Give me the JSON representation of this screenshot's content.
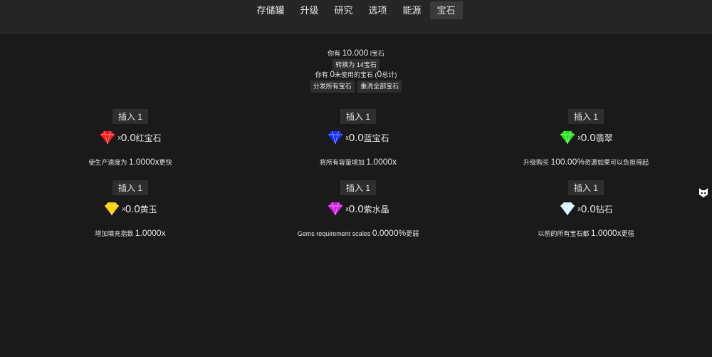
{
  "nav": {
    "tabs": [
      {
        "label": "存储罐",
        "active": false
      },
      {
        "label": "升级",
        "active": false
      },
      {
        "label": "研究",
        "active": false
      },
      {
        "label": "选项",
        "active": false
      },
      {
        "label": "能源",
        "active": false
      },
      {
        "label": "宝石",
        "active": true
      }
    ]
  },
  "info": {
    "have_prefix": "你有",
    "have_amount": "10.000",
    "have_unit": "l宝石",
    "convert_button": "转换为 14宝石",
    "unused_prefix": "你有",
    "unused_amount": "0",
    "unused_middle": "未使用的宝石 (",
    "unused_total": "0",
    "unused_suffix": "总计)",
    "distribute_button": "分发所有宝石",
    "reset_button": "重洗全部宝石"
  },
  "gems": [
    {
      "insert_label": "插入 1",
      "x": "x",
      "count": "0.0",
      "name": "红宝石",
      "effect_prefix": "使生产速度为 ",
      "effect_value": "1.0000x",
      "effect_suffix": "更快",
      "color": "#ff1a1a"
    },
    {
      "insert_label": "插入 1",
      "x": "x",
      "count": "0.0",
      "name": "蓝宝石",
      "effect_prefix": "将所有容量增加 ",
      "effect_value": "1.0000x",
      "effect_suffix": "",
      "color": "#1a2bff"
    },
    {
      "insert_label": "插入 1",
      "x": "x",
      "count": "0.0",
      "name": "翡翠",
      "effect_prefix": "升级购买 ",
      "effect_value": "100.00%",
      "effect_suffix": "资源如果可以负担得起",
      "color": "#22e01a"
    },
    {
      "insert_label": "插入 1",
      "x": "x",
      "count": "0.0",
      "name": "黄玉",
      "effect_prefix": "增加填充指数 ",
      "effect_value": "1.0000x",
      "effect_suffix": "",
      "color": "#ffcc00"
    },
    {
      "insert_label": "插入 1",
      "x": "x",
      "count": "0.0",
      "name": "紫水晶",
      "effect_prefix": "Gems requirement scales ",
      "effect_value": "0.0000%",
      "effect_suffix": "更弱",
      "color": "#d21ee0"
    },
    {
      "insert_label": "插入 1",
      "x": "x",
      "count": "0.0",
      "name": "钻石",
      "effect_prefix": "以前的所有宝石都 ",
      "effect_value": "1.0000x",
      "effect_suffix": "更强",
      "color": "#d8f0ff"
    }
  ],
  "icons": {
    "side_icon": "cat-face-icon"
  }
}
